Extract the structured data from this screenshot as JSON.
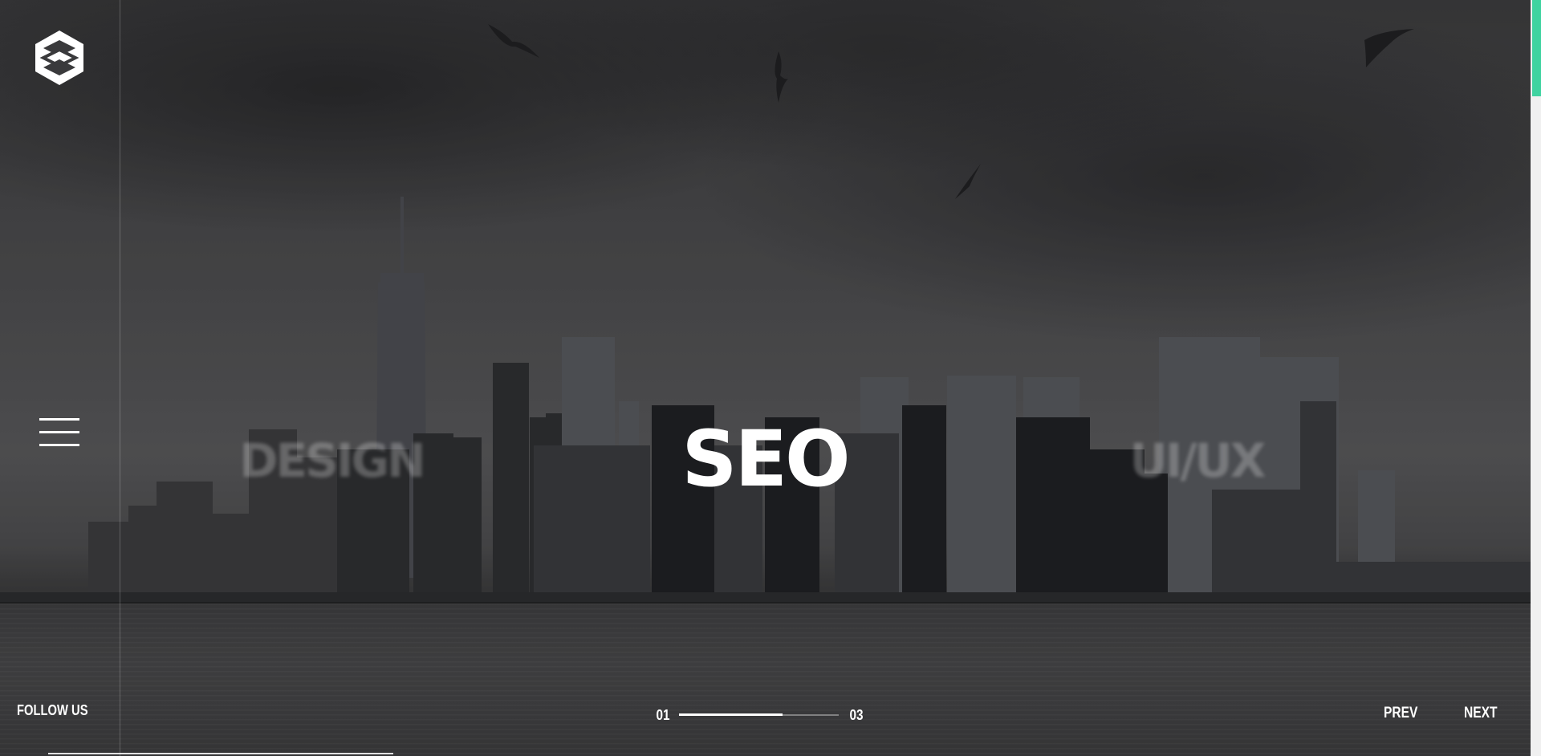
{
  "brand": {
    "logo_icon": "hexagon-logo-icon"
  },
  "sidebar": {
    "menu_icon": "hamburger-menu-icon",
    "follow_label": "FOLLOW US"
  },
  "slider": {
    "prev_title": "DESIGN",
    "active_title": "SEO",
    "next_title": "UI/UX",
    "current_index": "01",
    "total": "03",
    "progress": 0.65,
    "prev_label": "PREV",
    "next_label": "NEXT"
  },
  "colors": {
    "accent": "#3fd3a0",
    "text": "#ffffff"
  }
}
